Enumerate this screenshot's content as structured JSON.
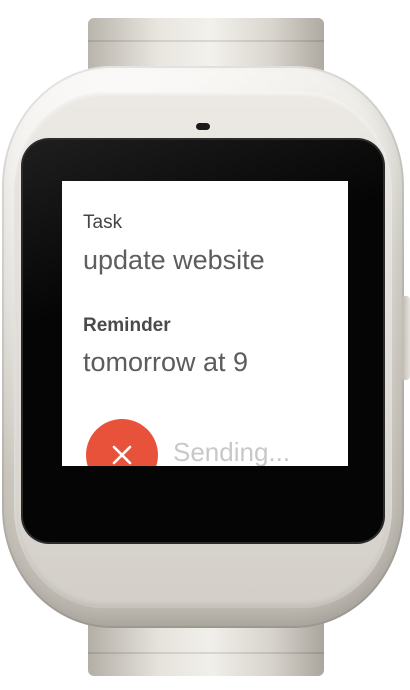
{
  "task": {
    "label": "Task",
    "value": "update website"
  },
  "reminder": {
    "label": "Reminder",
    "value": "tomorrow at 9"
  },
  "action": {
    "icon": "close-icon",
    "color": "#e8523a"
  },
  "status": {
    "text": "Sending..."
  }
}
